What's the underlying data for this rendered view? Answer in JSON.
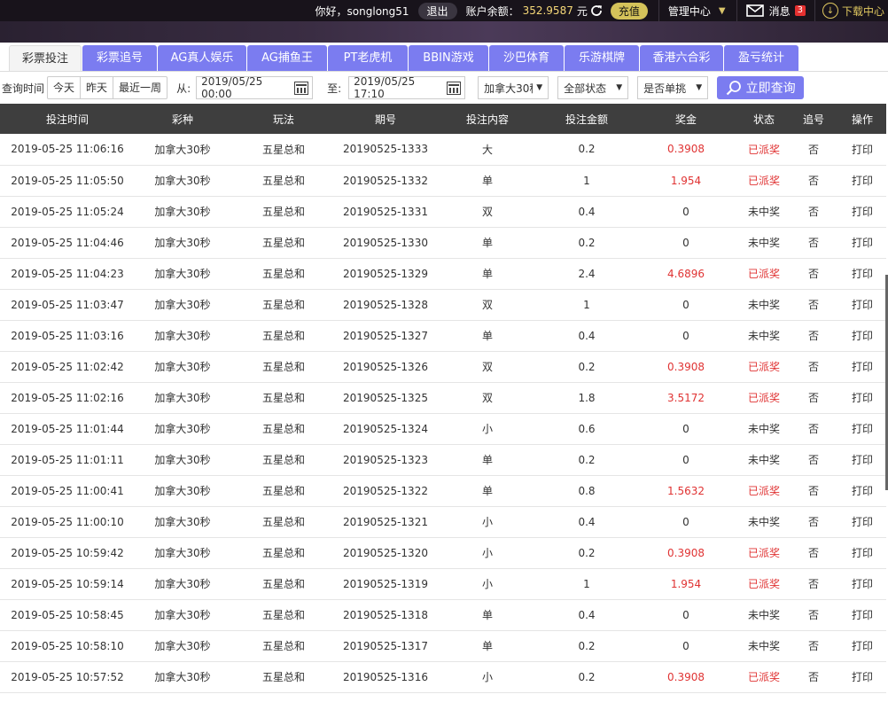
{
  "header": {
    "greeting": "你好，songlong51",
    "logout": "退出",
    "balance_label": "账户余额：",
    "balance_value": "352.9587",
    "balance_unit": "元",
    "recharge": "充值",
    "manage": "管理中心",
    "messages": "消息",
    "message_count": "3",
    "download": "下载中心"
  },
  "tabs": [
    {
      "label": "彩票投注"
    },
    {
      "label": "彩票追号"
    },
    {
      "label": "AG真人娱乐"
    },
    {
      "label": "AG捕鱼王"
    },
    {
      "label": "PT老虎机"
    },
    {
      "label": "BBIN游戏"
    },
    {
      "label": "沙巴体育"
    },
    {
      "label": "乐游棋牌"
    },
    {
      "label": "香港六合彩"
    },
    {
      "label": "盈亏统计"
    }
  ],
  "filters": {
    "query_time_label": "查询时间",
    "quick": [
      "今天",
      "昨天",
      "最近一周"
    ],
    "from_label": "从:",
    "from_value": "2019/05/25 00:00",
    "to_label": "至:",
    "to_value": "2019/05/25 17:10",
    "lottery_select": "加拿大30秒",
    "status_select": "全部状态",
    "single_select": "是否单挑",
    "query_button": "立即查询"
  },
  "table": {
    "headers": [
      "投注时间",
      "彩种",
      "玩法",
      "期号",
      "投注内容",
      "投注金额",
      "奖金",
      "状态",
      "追号",
      "操作"
    ],
    "rows": [
      {
        "time": "2019-05-25 11:06:16",
        "lottery": "加拿大30秒",
        "play": "五星总和",
        "issue": "20190525-1333",
        "content": "大",
        "amount": "0.2",
        "prize": "0.3908",
        "status": "已派奖",
        "chase": "否",
        "op": "打印"
      },
      {
        "time": "2019-05-25 11:05:50",
        "lottery": "加拿大30秒",
        "play": "五星总和",
        "issue": "20190525-1332",
        "content": "单",
        "amount": "1",
        "prize": "1.954",
        "status": "已派奖",
        "chase": "否",
        "op": "打印"
      },
      {
        "time": "2019-05-25 11:05:24",
        "lottery": "加拿大30秒",
        "play": "五星总和",
        "issue": "20190525-1331",
        "content": "双",
        "amount": "0.4",
        "prize": "0",
        "status": "未中奖",
        "chase": "否",
        "op": "打印"
      },
      {
        "time": "2019-05-25 11:04:46",
        "lottery": "加拿大30秒",
        "play": "五星总和",
        "issue": "20190525-1330",
        "content": "单",
        "amount": "0.2",
        "prize": "0",
        "status": "未中奖",
        "chase": "否",
        "op": "打印"
      },
      {
        "time": "2019-05-25 11:04:23",
        "lottery": "加拿大30秒",
        "play": "五星总和",
        "issue": "20190525-1329",
        "content": "单",
        "amount": "2.4",
        "prize": "4.6896",
        "status": "已派奖",
        "chase": "否",
        "op": "打印"
      },
      {
        "time": "2019-05-25 11:03:47",
        "lottery": "加拿大30秒",
        "play": "五星总和",
        "issue": "20190525-1328",
        "content": "双",
        "amount": "1",
        "prize": "0",
        "status": "未中奖",
        "chase": "否",
        "op": "打印"
      },
      {
        "time": "2019-05-25 11:03:16",
        "lottery": "加拿大30秒",
        "play": "五星总和",
        "issue": "20190525-1327",
        "content": "单",
        "amount": "0.4",
        "prize": "0",
        "status": "未中奖",
        "chase": "否",
        "op": "打印"
      },
      {
        "time": "2019-05-25 11:02:42",
        "lottery": "加拿大30秒",
        "play": "五星总和",
        "issue": "20190525-1326",
        "content": "双",
        "amount": "0.2",
        "prize": "0.3908",
        "status": "已派奖",
        "chase": "否",
        "op": "打印"
      },
      {
        "time": "2019-05-25 11:02:16",
        "lottery": "加拿大30秒",
        "play": "五星总和",
        "issue": "20190525-1325",
        "content": "双",
        "amount": "1.8",
        "prize": "3.5172",
        "status": "已派奖",
        "chase": "否",
        "op": "打印"
      },
      {
        "time": "2019-05-25 11:01:44",
        "lottery": "加拿大30秒",
        "play": "五星总和",
        "issue": "20190525-1324",
        "content": "小",
        "amount": "0.6",
        "prize": "0",
        "status": "未中奖",
        "chase": "否",
        "op": "打印"
      },
      {
        "time": "2019-05-25 11:01:11",
        "lottery": "加拿大30秒",
        "play": "五星总和",
        "issue": "20190525-1323",
        "content": "单",
        "amount": "0.2",
        "prize": "0",
        "status": "未中奖",
        "chase": "否",
        "op": "打印"
      },
      {
        "time": "2019-05-25 11:00:41",
        "lottery": "加拿大30秒",
        "play": "五星总和",
        "issue": "20190525-1322",
        "content": "单",
        "amount": "0.8",
        "prize": "1.5632",
        "status": "已派奖",
        "chase": "否",
        "op": "打印"
      },
      {
        "time": "2019-05-25 11:00:10",
        "lottery": "加拿大30秒",
        "play": "五星总和",
        "issue": "20190525-1321",
        "content": "小",
        "amount": "0.4",
        "prize": "0",
        "status": "未中奖",
        "chase": "否",
        "op": "打印"
      },
      {
        "time": "2019-05-25 10:59:42",
        "lottery": "加拿大30秒",
        "play": "五星总和",
        "issue": "20190525-1320",
        "content": "小",
        "amount": "0.2",
        "prize": "0.3908",
        "status": "已派奖",
        "chase": "否",
        "op": "打印"
      },
      {
        "time": "2019-05-25 10:59:14",
        "lottery": "加拿大30秒",
        "play": "五星总和",
        "issue": "20190525-1319",
        "content": "小",
        "amount": "1",
        "prize": "1.954",
        "status": "已派奖",
        "chase": "否",
        "op": "打印"
      },
      {
        "time": "2019-05-25 10:58:45",
        "lottery": "加拿大30秒",
        "play": "五星总和",
        "issue": "20190525-1318",
        "content": "单",
        "amount": "0.4",
        "prize": "0",
        "status": "未中奖",
        "chase": "否",
        "op": "打印"
      },
      {
        "time": "2019-05-25 10:58:10",
        "lottery": "加拿大30秒",
        "play": "五星总和",
        "issue": "20190525-1317",
        "content": "单",
        "amount": "0.2",
        "prize": "0",
        "status": "未中奖",
        "chase": "否",
        "op": "打印"
      },
      {
        "time": "2019-05-25 10:57:52",
        "lottery": "加拿大30秒",
        "play": "五星总和",
        "issue": "20190525-1316",
        "content": "小",
        "amount": "0.2",
        "prize": "0.3908",
        "status": "已派奖",
        "chase": "否",
        "op": "打印"
      }
    ]
  },
  "colors": {
    "accent": "#7b7cf0",
    "win_red": "#e03333",
    "gold": "#f6d878",
    "header_dark": "#3e3e3e"
  }
}
